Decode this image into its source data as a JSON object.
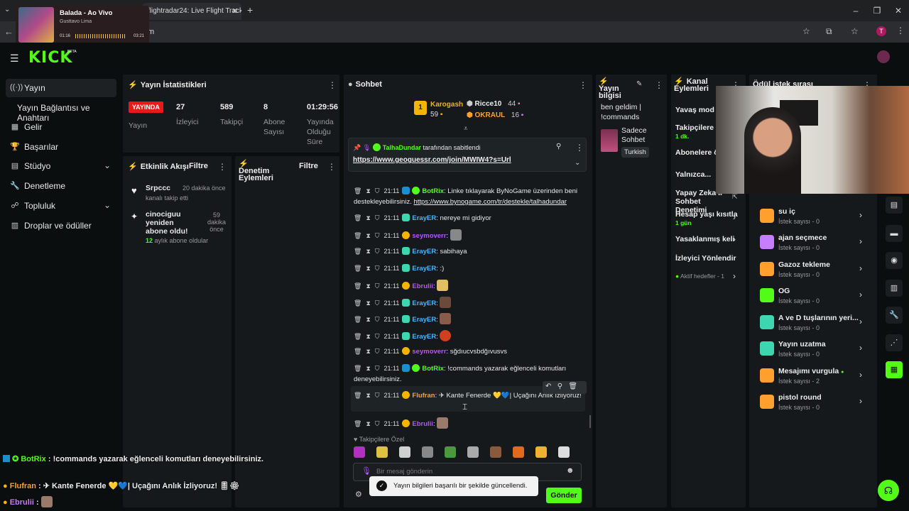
{
  "browser": {
    "tab_title": "flightradar24: Live Flight Tracke",
    "address_suffix": "m",
    "new_tab": "+",
    "profile_initial": "T"
  },
  "media": {
    "song": "Balada - Ao Vivo",
    "artist": "Gusttavo Lima",
    "elapsed": "01:16",
    "total": "03:21"
  },
  "kick": {
    "logo": "KICK",
    "logo_tag": "BETA"
  },
  "sidebar": {
    "items": [
      {
        "label": "Yayın",
        "icon": "broadcast-icon"
      },
      {
        "label": "Yayın Bağlantısı ve Anahtarı",
        "icon": ""
      },
      {
        "label": "Gelir",
        "icon": "revenue-icon"
      },
      {
        "label": "Başarılar",
        "icon": "trophy-icon"
      },
      {
        "label": "Stüdyo",
        "icon": "studio-icon"
      },
      {
        "label": "Denetleme",
        "icon": "wrench-icon"
      },
      {
        "label": "Topluluk",
        "icon": "community-icon"
      },
      {
        "label": "Droplar ve ödüller",
        "icon": "drops-icon"
      }
    ]
  },
  "stats": {
    "title": "Yayın İstatistikleri",
    "live_badge": "YAYINDA",
    "live_label": "Yayın",
    "viewers": {
      "value": "27",
      "label": "İzleyici"
    },
    "followers": {
      "value": "589",
      "label": "Takipçi"
    },
    "subs": {
      "value": "8",
      "label1": "Abone",
      "label2": "Sayısı"
    },
    "uptime": {
      "value": "01:29:56",
      "label1": "Yayında",
      "label2": "Olduğu",
      "label3": "Süre"
    }
  },
  "activity": {
    "title": "Etkinlik Akışı",
    "filter": "Filtre",
    "events": [
      {
        "user": "Srpccc",
        "text": "kanalı takip etti",
        "time": "20 dakika önce"
      },
      {
        "user": "cinociguu yeniden abone oldu!",
        "months": "12",
        "text": "aylık abone oldular",
        "time1": "59",
        "time2": "dakika",
        "time3": "önce"
      }
    ]
  },
  "moderation": {
    "title1": "Denetim",
    "title2": "Eylemleri",
    "filter": "Filtre"
  },
  "chat": {
    "title": "Sohbet",
    "top_gifters": [
      {
        "name": "Karogash",
        "count": "59"
      },
      {
        "name": "Ricce10",
        "count": "44"
      },
      {
        "name": "OKRAUL",
        "count": "16"
      }
    ],
    "pinned": {
      "user": "TalhaDundar",
      "text": "tarafından sabitlendi",
      "link": "https://www.geoguessr.com/join/MWIW4?s=Url"
    },
    "messages": [
      {
        "time": "21:11",
        "user": "BotRix",
        "sep": ":",
        "text": "Linke tıklayarak ByNoGame üzerinden beni destekleyebilirsiniz.",
        "link": "https://www.bynogame.com/tr/destekle/talhadundar"
      },
      {
        "time": "21:11",
        "user": "ErayER",
        "sep": ":",
        "text": "nereye mi gidiyor"
      },
      {
        "time": "21:11",
        "user": "seymoverr",
        "sep": ":",
        "text": ""
      },
      {
        "time": "21:11",
        "user": "ErayER",
        "sep": ":",
        "text": "sabihaya"
      },
      {
        "time": "21:11",
        "user": "ErayER",
        "sep": ":",
        "text": ":)"
      },
      {
        "time": "21:11",
        "user": "Ebrulii",
        "sep": ":",
        "text": ""
      },
      {
        "time": "21:11",
        "user": "ErayER",
        "sep": ":",
        "text": ""
      },
      {
        "time": "21:11",
        "user": "ErayER",
        "sep": ":",
        "text": ""
      },
      {
        "time": "21:11",
        "user": "ErayER",
        "sep": ":",
        "text": ""
      },
      {
        "time": "21:11",
        "user": "seymoverr",
        "sep": ":",
        "text": "sğdıucvsbdğıvusvs"
      },
      {
        "time": "21:11",
        "user": "BotRix",
        "sep": ":",
        "text": "!commands yazarak eğlenceli komutları deneyebilirsiniz."
      },
      {
        "time": "21:11",
        "user": "Flufran",
        "sep": ":",
        "text": "✈ Kante Fenerde 💛💙| Uçağını Anlık İzliyoruz!"
      },
      {
        "time": "21:11",
        "user": "Ebrulii",
        "sep": ":",
        "text": ""
      }
    ],
    "emote_section": "Takipçilere Özel",
    "input_placeholder": "Bir mesaj gönderin",
    "send": "Gönder",
    "toast": "Yayın bilgileri başarılı bir şekilde güncellendi."
  },
  "stream_info": {
    "title1": "Yayın",
    "title2": "bilgisi",
    "stream_title": "ben geldim | !commands",
    "category": "Sadece Sohbet",
    "language": "Turkish"
  },
  "channel_actions": {
    "title1": "Kanal",
    "title2": "Eylemleri",
    "items": [
      {
        "label": "Yavaş mod",
        "sub": ""
      },
      {
        "label": "Takipçilere ö",
        "sub": "1 dk."
      },
      {
        "label": "Abonelere ö",
        "sub": ""
      },
      {
        "label": "Yalnızca...",
        "sub": ""
      },
      {
        "label": "Yapay Zeka il Sohbet Denetimi",
        "sub": ""
      },
      {
        "label": "Hesap yaşı kısıtla",
        "sub": "1 gün"
      },
      {
        "label": "Yasaklanmış keli",
        "sub": ""
      },
      {
        "label": "İzleyici Yönlendir",
        "sub": ""
      },
      {
        "label": "Aktif hedefler - 1",
        "sub": ""
      }
    ]
  },
  "rewards": {
    "title": "Ödül istek sırası",
    "items": [
      {
        "name": "su iç",
        "sub": "İstek sayısı - 0",
        "color": "#ff9f2e"
      },
      {
        "name": "ajan seçmece",
        "sub": "İstek sayısı - 0",
        "color": "#c77dff"
      },
      {
        "name": "Gazoz tekleme",
        "sub": "İstek sayısı - 0",
        "color": "#ff9f2e"
      },
      {
        "name": "OG",
        "sub": "İstek sayısı - 0",
        "color": "#53fc18"
      },
      {
        "name": "A ve D tuşlarının yeri...",
        "sub": "İstek sayısı - 0",
        "color": "#3ed6b0"
      },
      {
        "name": "Yayın uzatma",
        "sub": "İstek sayısı - 0",
        "color": "#3ed6b0"
      },
      {
        "name": "Mesajımı vurgula",
        "sub": "İstek sayısı - 2",
        "color": "#ff9f2e"
      },
      {
        "name": "pistol round",
        "sub": "İstek sayısı - 0",
        "color": "#ff9f2e"
      }
    ]
  },
  "overlay_chat": [
    {
      "user": "BotRix",
      "text": "!commands yazarak eğlenceli komutları deneyebilirsiniz."
    },
    {
      "user": "Flufran",
      "text": "✈ Kante Fenerde 💛💙| Uçağını Anlık İzliyoruz! 🎚⚙"
    },
    {
      "user": "Ebrulii",
      "text": ""
    }
  ],
  "colors": {
    "brand": "#53fc18",
    "live": "#e91916"
  }
}
